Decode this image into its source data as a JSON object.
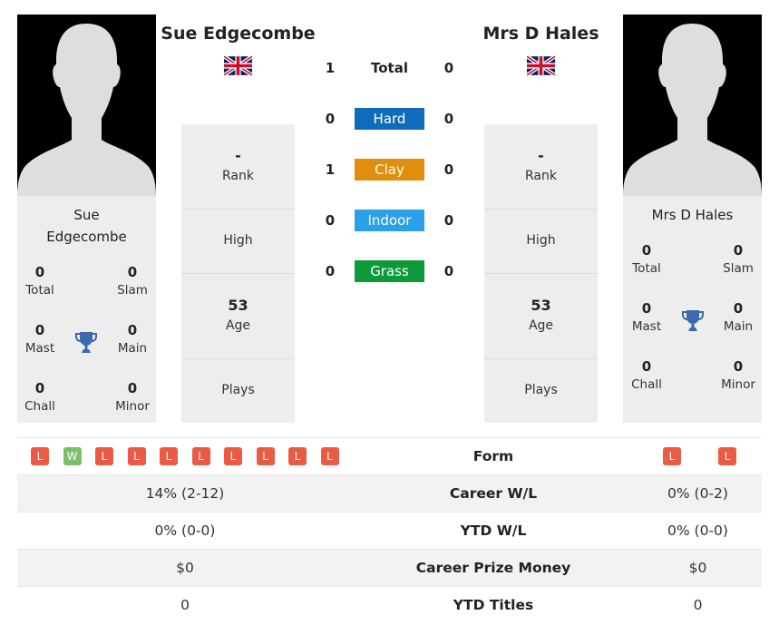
{
  "player1": {
    "name": "Sue Edgecombe",
    "name_line1": "Sue",
    "name_line2": "Edgecombe",
    "flag": "united-kingdom-flag",
    "rank": {
      "value": "-",
      "label": "Rank"
    },
    "high": {
      "value": "",
      "label": "High"
    },
    "age": {
      "value": "53",
      "label": "Age"
    },
    "plays": {
      "value": "",
      "label": "Plays"
    },
    "titles": {
      "total": {
        "value": "0",
        "label": "Total"
      },
      "slam": {
        "value": "0",
        "label": "Slam"
      },
      "mast": {
        "value": "0",
        "label": "Mast"
      },
      "main": {
        "value": "0",
        "label": "Main"
      },
      "chall": {
        "value": "0",
        "label": "Chall"
      },
      "minor": {
        "value": "0",
        "label": "Minor"
      }
    }
  },
  "player2": {
    "name": "Mrs D Hales",
    "flag": "united-kingdom-flag",
    "rank": {
      "value": "-",
      "label": "Rank"
    },
    "high": {
      "value": "",
      "label": "High"
    },
    "age": {
      "value": "53",
      "label": "Age"
    },
    "plays": {
      "value": "",
      "label": "Plays"
    },
    "titles": {
      "total": {
        "value": "0",
        "label": "Total"
      },
      "slam": {
        "value": "0",
        "label": "Slam"
      },
      "mast": {
        "value": "0",
        "label": "Mast"
      },
      "main": {
        "value": "0",
        "label": "Main"
      },
      "chall": {
        "value": "0",
        "label": "Chall"
      },
      "minor": {
        "value": "0",
        "label": "Minor"
      }
    }
  },
  "h2h": {
    "total": {
      "label": "Total",
      "p1": "1",
      "p2": "0"
    },
    "surfaces": [
      {
        "label": "Hard",
        "p1": "0",
        "p2": "0",
        "color": "#0f6cbd"
      },
      {
        "label": "Clay",
        "p1": "1",
        "p2": "0",
        "color": "#e08e0b"
      },
      {
        "label": "Indoor",
        "p1": "0",
        "p2": "0",
        "color": "#2aa0e8"
      },
      {
        "label": "Grass",
        "p1": "0",
        "p2": "0",
        "color": "#0e9a3b"
      }
    ]
  },
  "comparison": {
    "form": {
      "label": "Form",
      "p1": [
        "L",
        "W",
        "L",
        "L",
        "L",
        "L",
        "L",
        "L",
        "L",
        "L"
      ],
      "p2": [
        "L",
        "L"
      ]
    },
    "rows": [
      {
        "label": "Career W/L",
        "p1": "14% (2-12)",
        "p2": "0% (0-2)"
      },
      {
        "label": "YTD W/L",
        "p1": "0% (0-0)",
        "p2": "0% (0-0)"
      },
      {
        "label": "Career Prize Money",
        "p1": "$0",
        "p2": "$0"
      },
      {
        "label": "YTD Titles",
        "p1": "0",
        "p2": "0"
      }
    ]
  },
  "colors": {
    "form_loss": "#ea5a45",
    "form_win": "#7cbf6b",
    "trophy": "#3b6ab0"
  }
}
